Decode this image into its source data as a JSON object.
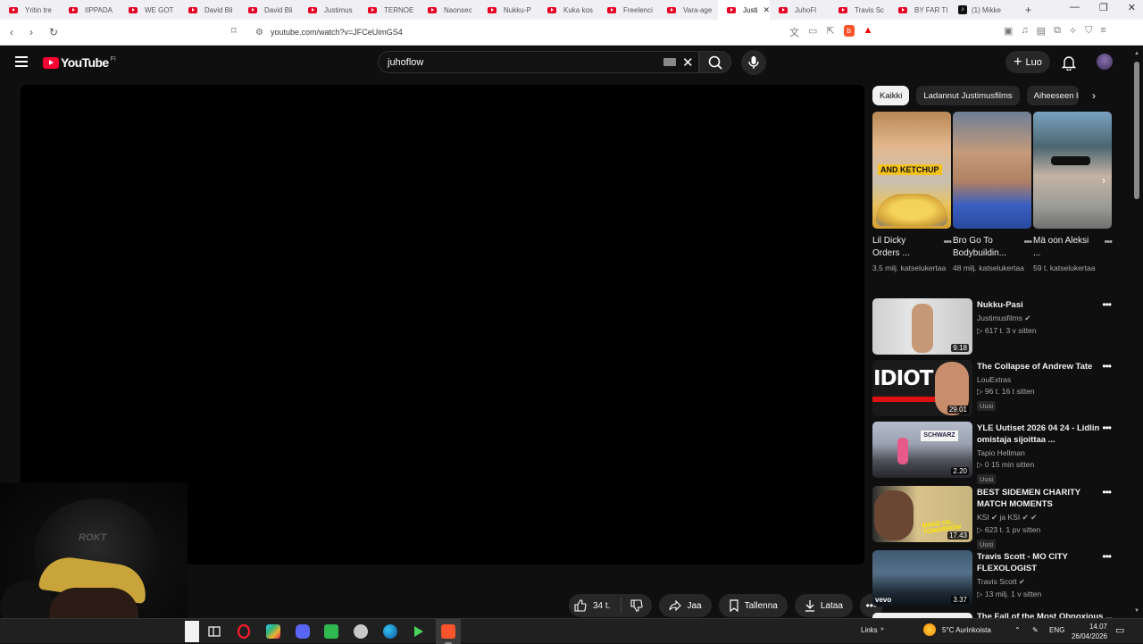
{
  "browser": {
    "tabs": [
      {
        "label": "Yritin tre",
        "icon": "youtube-icon"
      },
      {
        "label": "IIPPADA",
        "icon": "youtube-icon"
      },
      {
        "label": "WE GOT",
        "icon": "youtube-icon"
      },
      {
        "label": "David Bli",
        "icon": "youtube-icon"
      },
      {
        "label": "David Bli",
        "icon": "youtube-icon"
      },
      {
        "label": "Justimus",
        "icon": "youtube-icon"
      },
      {
        "label": "TERNOE",
        "icon": "youtube-icon"
      },
      {
        "label": "Naonsec",
        "icon": "youtube-icon"
      },
      {
        "label": "Nukku-P",
        "icon": "youtube-icon"
      },
      {
        "label": "Kuka kos",
        "icon": "youtube-icon"
      },
      {
        "label": "Freelenci",
        "icon": "youtube-icon"
      },
      {
        "label": "Vara-age",
        "icon": "youtube-icon"
      },
      {
        "label": "Justi",
        "icon": "youtube-icon",
        "active": true
      },
      {
        "label": "JuhoFl",
        "icon": "youtube-icon"
      },
      {
        "label": "Travis Sc",
        "icon": "youtube-icon"
      },
      {
        "label": "BY FAR TI",
        "icon": "youtube-icon"
      },
      {
        "label": "(1) Mikke",
        "icon": "tiktok-icon"
      }
    ],
    "url": "youtube.com/watch?v=JFCeUimGS4",
    "accent": "#fb542b"
  },
  "youtube": {
    "logo_text": "YouTube",
    "country_code": "FI",
    "search_value": "juhoflow",
    "create_label": "Luo"
  },
  "actions": {
    "likes": "34 t.",
    "share": "Jaa",
    "save": "Tallenna",
    "download": "Lataa"
  },
  "chips": [
    {
      "label": "Kaikki",
      "active": true
    },
    {
      "label": "Ladannut Justimusfilms",
      "active": false
    },
    {
      "label": "Aiheeseen li",
      "active": false
    }
  ],
  "shorts": [
    {
      "title": "Lil Dicky Orders ...",
      "views": "3,5 milj. katselukertaa",
      "overlay": "AND KETCHUP"
    },
    {
      "title": "Bro Go To Bodybuildin...",
      "views": "48 milj. katselukertaa"
    },
    {
      "title": "Mä oon Aleksi ...",
      "views": "59 t. katselukertaa"
    }
  ],
  "videos": [
    {
      "title": "Nukku-Pasi",
      "channel": "Justimusfilms ✔",
      "stats": "▷ 617 t.  3 v sitten",
      "duration": "9.18",
      "badge": ""
    },
    {
      "title": "The Collapse of Andrew Tate",
      "channel": "LouExtras",
      "stats": "▷ 96 t.  16 t sitten",
      "duration": "29.01",
      "badge": "Uusi",
      "overlay": "IDIOT"
    },
    {
      "title": "YLE Uutiset 2026 04 24 - Lidlin omistaja sijoittaa ...",
      "channel": "Tapio Hellman",
      "stats": "▷ 0  15 min sitten",
      "duration": "2.20",
      "badge": "Uusi",
      "overlay": "SCHWARZ"
    },
    {
      "title": "BEST SIDEMEN CHARITY MATCH MOMENTS",
      "channel": "KSI ✔ ja KSI ✔ ✔",
      "stats": "▷ 623 t.  1 pv sitten",
      "duration": "17.43",
      "badge": "Uusi",
      "overlay": "MAKE US... TOMORROW"
    },
    {
      "title": "Travis Scott - MO CITY FLEXOLOGIST",
      "channel": "Travis Scott ✔",
      "stats": "▷ 13 milj.  1 v sitten",
      "duration": "3.37",
      "badge": "",
      "overlay": "vevo"
    }
  ],
  "last_video_title": "The Fall of the Most Obnoxious ...",
  "taskbar": {
    "links_label": "Links",
    "weather": "5°C  Aurinkoista",
    "lang": "ENG",
    "time": "14.07",
    "date": "26/04/2026"
  }
}
